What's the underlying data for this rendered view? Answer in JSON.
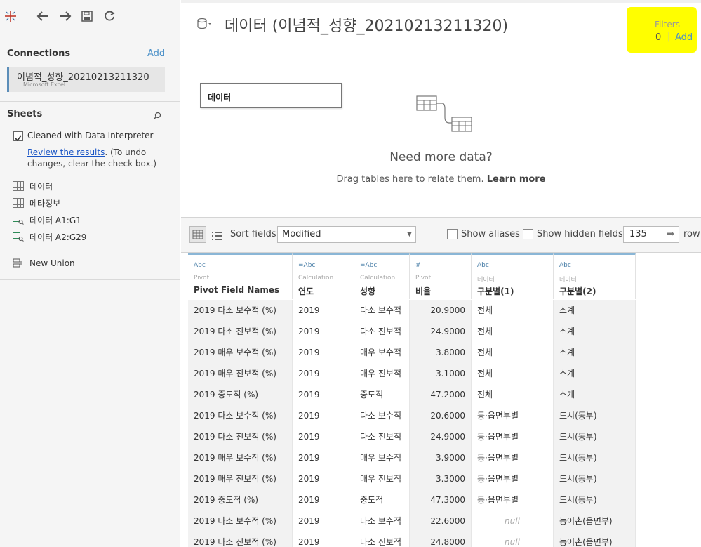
{
  "toolbar": {
    "icons": [
      "tableau-logo-icon",
      "back-icon",
      "forward-icon",
      "save-icon",
      "refresh-icon"
    ]
  },
  "connections": {
    "title": "Connections",
    "add": "Add",
    "item": {
      "name": "이념적_성향_20210213211320",
      "type": "Microsoft Excel"
    }
  },
  "sheets": {
    "title": "Sheets",
    "interpreter_label": "Cleaned with Data Interpreter",
    "review_link": "Review the results",
    "review_rest": ". (To undo",
    "review_line2": "changes, clear the check box.)",
    "items": [
      {
        "label": "데이터",
        "icon": "sheet-icon"
      },
      {
        "label": "메타정보",
        "icon": "sheet-icon"
      },
      {
        "label": "데이터 A1:G1",
        "icon": "named-range-icon"
      },
      {
        "label": "데이터 A2:G29",
        "icon": "named-range-icon"
      }
    ],
    "new_union": "New Union"
  },
  "canvas": {
    "title": "데이터 (이념적_성향_20210213211320)",
    "filters_label": "Filters",
    "filters_count": "0",
    "filters_sep": "|",
    "filters_add": "Add",
    "table_name": "데이터",
    "need_more": "Need more data?",
    "drag_text": "Drag tables here to relate them.",
    "learn_more": "Learn more"
  },
  "gridbar": {
    "sort_label": "Sort fields",
    "sort_value": "Modified",
    "show_aliases": "Show aliases",
    "show_hidden": "Show hidden fields",
    "rows_value": "135",
    "rows_label": "row"
  },
  "columns": [
    {
      "type": "Abc",
      "source": "Pivot",
      "name": "Pivot Field Names"
    },
    {
      "type": "=Abc",
      "source": "Calculation",
      "name": "연도"
    },
    {
      "type": "=Abc",
      "source": "Calculation",
      "name": "성향"
    },
    {
      "type": "#",
      "source": "Pivot",
      "name": "비율"
    },
    {
      "type": "Abc",
      "source": "데이터",
      "name": "구분별(1)"
    },
    {
      "type": "Abc",
      "source": "데이터",
      "name": "구분별(2)"
    }
  ],
  "rows": [
    [
      "2019 다소 보수적 (%)",
      "2019",
      "다소 보수적",
      "20.9000",
      "전체",
      "소계"
    ],
    [
      "2019 다소 진보적 (%)",
      "2019",
      "다소 진보적",
      "24.9000",
      "전체",
      "소계"
    ],
    [
      "2019 매우 보수적 (%)",
      "2019",
      "매우 보수적",
      "3.8000",
      "전체",
      "소계"
    ],
    [
      "2019 매우 진보적 (%)",
      "2019",
      "매우 진보적",
      "3.1000",
      "전체",
      "소계"
    ],
    [
      "2019 중도적 (%)",
      "2019",
      "중도적",
      "47.2000",
      "전체",
      "소계"
    ],
    [
      "2019 다소 보수적 (%)",
      "2019",
      "다소 보수적",
      "20.6000",
      "동·읍면부별",
      "도시(동부)"
    ],
    [
      "2019 다소 진보적 (%)",
      "2019",
      "다소 진보적",
      "24.9000",
      "동·읍면부별",
      "도시(동부)"
    ],
    [
      "2019 매우 보수적 (%)",
      "2019",
      "매우 보수적",
      "3.9000",
      "동·읍면부별",
      "도시(동부)"
    ],
    [
      "2019 매우 진보적 (%)",
      "2019",
      "매우 진보적",
      "3.3000",
      "동·읍면부별",
      "도시(동부)"
    ],
    [
      "2019 중도적 (%)",
      "2019",
      "중도적",
      "47.3000",
      "동·읍면부별",
      "도시(동부)"
    ],
    [
      "2019 다소 보수적 (%)",
      "2019",
      "다소 보수적",
      "22.6000",
      "null",
      "농어촌(읍면부)"
    ],
    [
      "2019 다소 진보적 (%)",
      "2019",
      "다소 진보적",
      "24.8000",
      "null",
      "농어촌(읍면부)"
    ]
  ],
  "colors": {
    "accent": "#4a7fa8",
    "highlight": "#fffe00",
    "link": "#1a55c5"
  }
}
